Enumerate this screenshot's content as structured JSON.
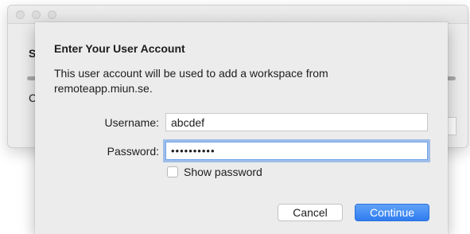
{
  "background_window": {
    "partial_text_top": "S",
    "partial_text_bottom": "C"
  },
  "dialog": {
    "title": "Enter Your User Account",
    "description": "This user account will be used to add a workspace from remoteapp.miun.se.",
    "username": {
      "label": "Username:",
      "value": "abcdef"
    },
    "password": {
      "label": "Password:",
      "masked_value": "••••••••••"
    },
    "show_password": {
      "label": "Show password",
      "checked": false
    },
    "buttons": {
      "cancel": "Cancel",
      "continue": "Continue"
    }
  },
  "colors": {
    "sheet_background": "#ececec",
    "focus_ring": "#5e97e7",
    "primary_button": "#2f7cf0"
  }
}
